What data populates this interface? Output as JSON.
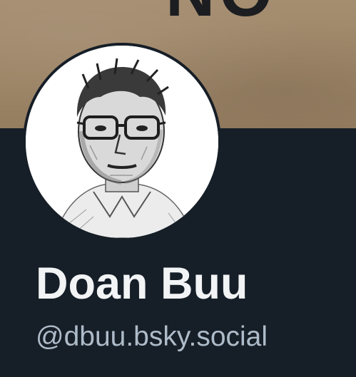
{
  "banner": {
    "text": "NO",
    "icon": "cardboard-banner-image"
  },
  "profile": {
    "avatar_icon": "avatar-sketch-portrait",
    "display_name": "Doan Buu",
    "handle": "@dbuu.bsky.social"
  },
  "colors": {
    "background": "#161e27",
    "banner": "#a08a6d",
    "name_text": "#f1f3f5",
    "handle_text": "#aebbc9"
  }
}
